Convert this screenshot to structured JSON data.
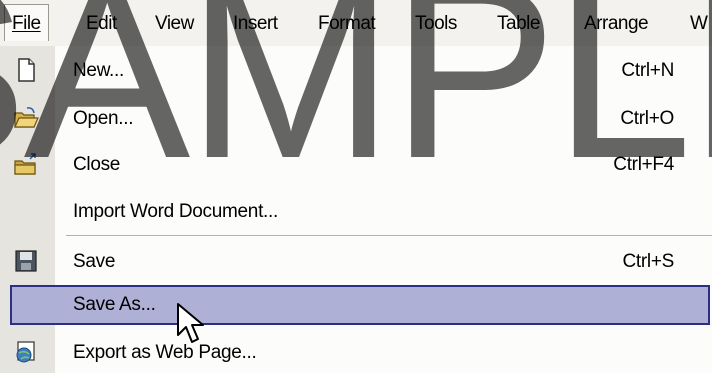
{
  "menubar": {
    "file": "File",
    "edit": "Edit",
    "view": "View",
    "insert": "Insert",
    "format": "Format",
    "tools": "Tools",
    "table": "Table",
    "arrange": "Arrange",
    "window_partial": "W"
  },
  "file_menu": {
    "items": [
      {
        "label": "New...",
        "shortcut": "Ctrl+N",
        "icon": "new-document-icon"
      },
      {
        "label": "Open...",
        "shortcut": "Ctrl+O",
        "icon": "open-folder-icon"
      },
      {
        "label": "Close",
        "shortcut": "Ctrl+F4",
        "icon": "close-folder-icon"
      },
      {
        "label": "Import Word Document...",
        "shortcut": "",
        "icon": ""
      },
      {
        "label": "Save",
        "shortcut": "Ctrl+S",
        "icon": "floppy-disk-icon"
      },
      {
        "label": "Save As...",
        "shortcut": "",
        "icon": "",
        "highlighted": true
      },
      {
        "label": "Export as Web Page...",
        "shortcut": "",
        "icon": "export-web-icon"
      }
    ]
  },
  "watermark": {
    "text": "SAMPLE"
  },
  "colors": {
    "highlight_fill": "#aeb0d6",
    "highlight_border": "#2c2f86",
    "gutter": "#e6e4de",
    "menubar": "#f3f2ee"
  }
}
